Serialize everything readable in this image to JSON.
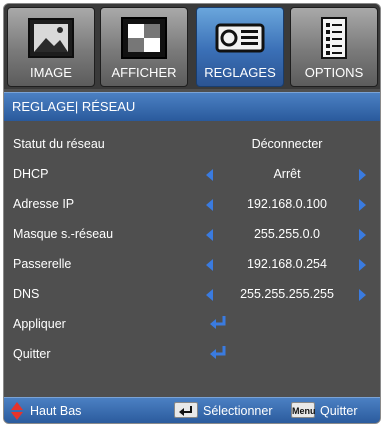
{
  "tabs": [
    {
      "label": "IMAGE",
      "icon": "image-picture-icon",
      "active": false
    },
    {
      "label": "AFFICHER",
      "icon": "display-screen-icon",
      "active": false
    },
    {
      "label": "REGLAGES",
      "icon": "projector-icon",
      "active": true
    },
    {
      "label": "OPTIONS",
      "icon": "options-document-icon",
      "active": false
    }
  ],
  "section_title": "REGLAGE| RÉSEAU",
  "rows": [
    {
      "label": "Statut du réseau",
      "value": "Déconnecter"
    },
    {
      "label": "DHCP",
      "value": "Arrêt"
    },
    {
      "label": "Adresse IP",
      "value": "192.168.0.100"
    },
    {
      "label": "Masque s.-réseau",
      "value": "255.255.0.0"
    },
    {
      "label": "Passerelle",
      "value": "192.168.0.254"
    },
    {
      "label": "DNS",
      "value": "255.255.255.255"
    },
    {
      "label": "Appliquer"
    },
    {
      "label": "Quitter"
    }
  ],
  "footer": {
    "nav_label": "Haut Bas",
    "enter_label": "Sélectionner",
    "menu_key": "Menu",
    "exit_label": "Quitter"
  },
  "colors": {
    "accent_blue": "#3a6fb6",
    "arrow_blue": "#3a7be0",
    "panel_gray": "#4f4f4f",
    "nav_red": "#e8332b"
  }
}
